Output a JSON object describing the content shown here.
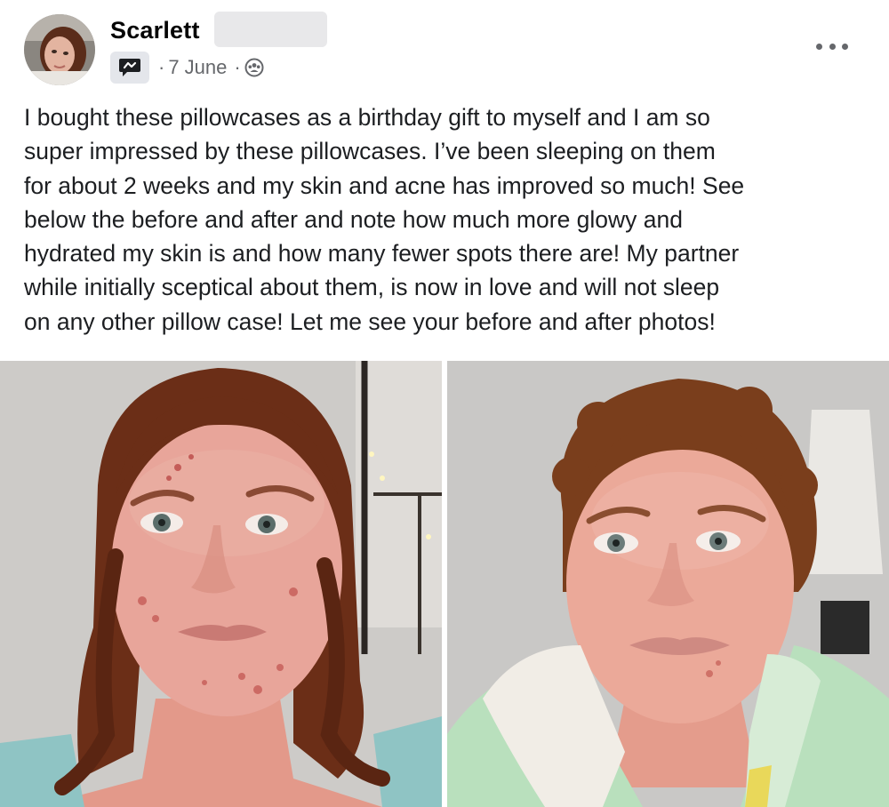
{
  "author": {
    "name": "Scarlett"
  },
  "meta": {
    "badge_icon": "group-badge-icon",
    "separator": "·",
    "date": "7 June",
    "audience_icon": "group-audience-icon"
  },
  "post": {
    "lines": [
      "I bought these pillowcases as a birthday gift to myself and I am so",
      "super impressed by these pillowcases. I’ve been sleeping on them",
      "for about 2 weeks and my skin and acne has improved so much! See",
      "below the before and after and note how much more glowy and",
      "hydrated my skin is and how many fewer spots there are! My partner",
      "while initially sceptical about them, is now in love and will not sleep",
      "on any other pillow case! Let me see your before and after photos!"
    ]
  },
  "photos": {
    "before": {
      "background": "#c9c6c4",
      "hair": "#6b2e17",
      "skin": "#e8a59a",
      "top": "#8fc4c4"
    },
    "after": {
      "background": "#c3c2c0",
      "hair": "#7a3e1c",
      "skin": "#eba999",
      "robe": "#b9e0bd"
    }
  },
  "colors": {
    "name": "#050505",
    "meta": "#65676b",
    "text": "#1c1e21",
    "redaction": "#e8e8ea"
  }
}
